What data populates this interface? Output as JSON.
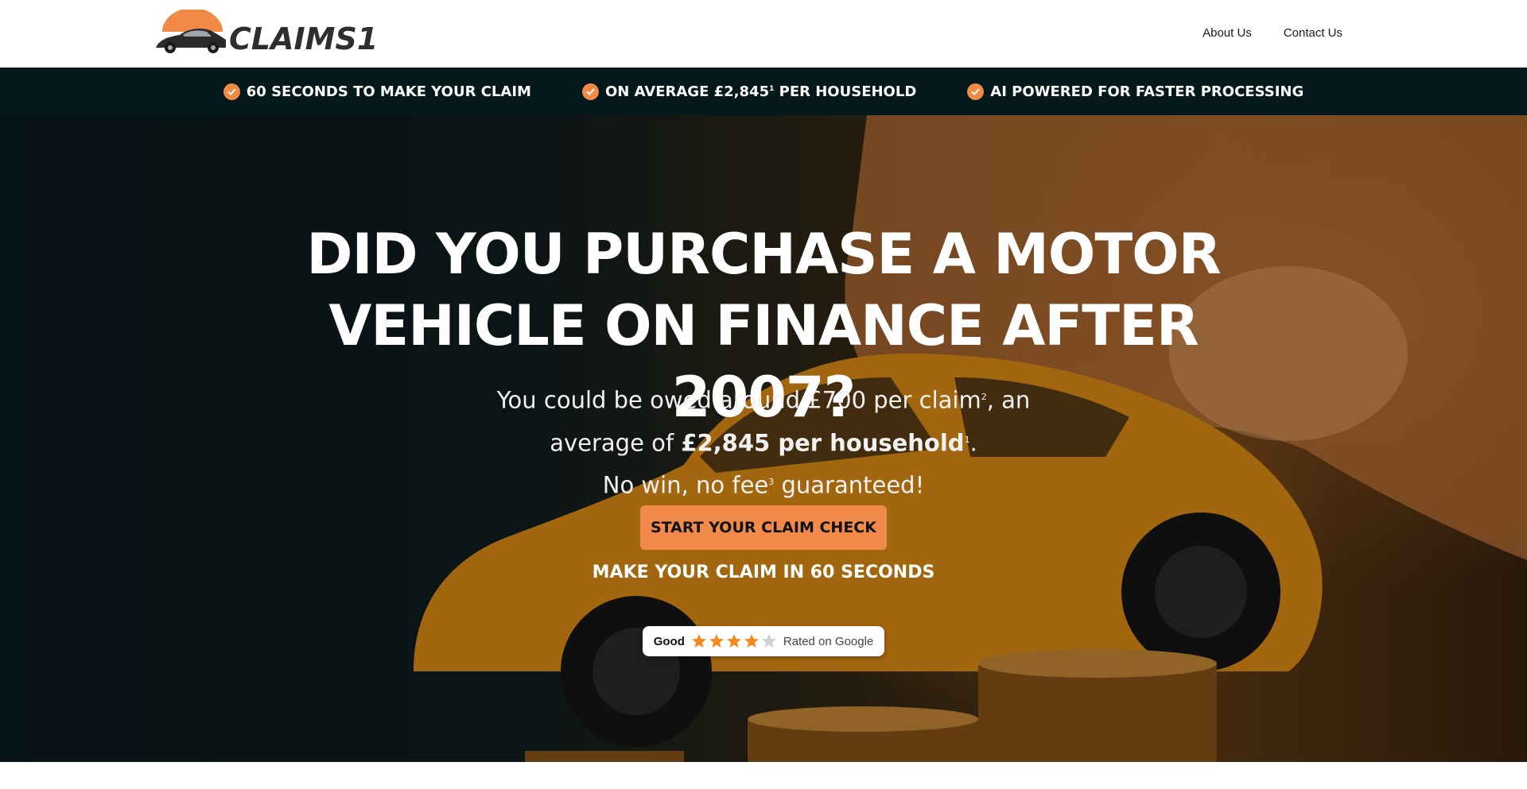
{
  "header": {
    "logo_text": "CLAIMS1",
    "nav": [
      {
        "label": "About Us"
      },
      {
        "label": "Contact Us"
      }
    ]
  },
  "benefits": [
    {
      "icon": "check-badge-icon",
      "text": "60 SECONDS TO MAKE YOUR CLAIM",
      "sup": ""
    },
    {
      "icon": "check-badge-icon",
      "text": "ON AVERAGE £2,845",
      "sup": "1",
      "text_after": " PER HOUSEHOLD"
    },
    {
      "icon": "check-badge-icon",
      "text": "AI POWERED FOR FASTER PROCESSING",
      "sup": ""
    }
  ],
  "hero": {
    "headline_line1": "DID YOU PURCHASE A MOTOR",
    "headline_line2": "VEHICLE ON FINANCE AFTER 2007?",
    "sub_line1_a": "You could be owed around £700 per claim",
    "sub_line1_sup": "2",
    "sub_line1_b": ", an",
    "sub_line2_a": "average of ",
    "sub_line2_bold": "£2,845 per household",
    "sub_line2_sup": "1",
    "sub_line2_b": ".",
    "sub_line3_a": "No win, no fee",
    "sub_line3_sup": "3",
    "sub_line3_b": " guaranteed!",
    "cta_label": "START YOUR CLAIM CHECK",
    "cta_caption": "MAKE YOUR CLAIM IN 60 SECONDS"
  },
  "rating": {
    "label": "Good",
    "stars": 4,
    "max_stars": 5,
    "source_text": "Rated on Google"
  },
  "colors": {
    "accent": "#f18a4b",
    "bar_bg": "#04191b",
    "star_filled": "#f5891f",
    "star_empty": "#d0d0d0"
  }
}
